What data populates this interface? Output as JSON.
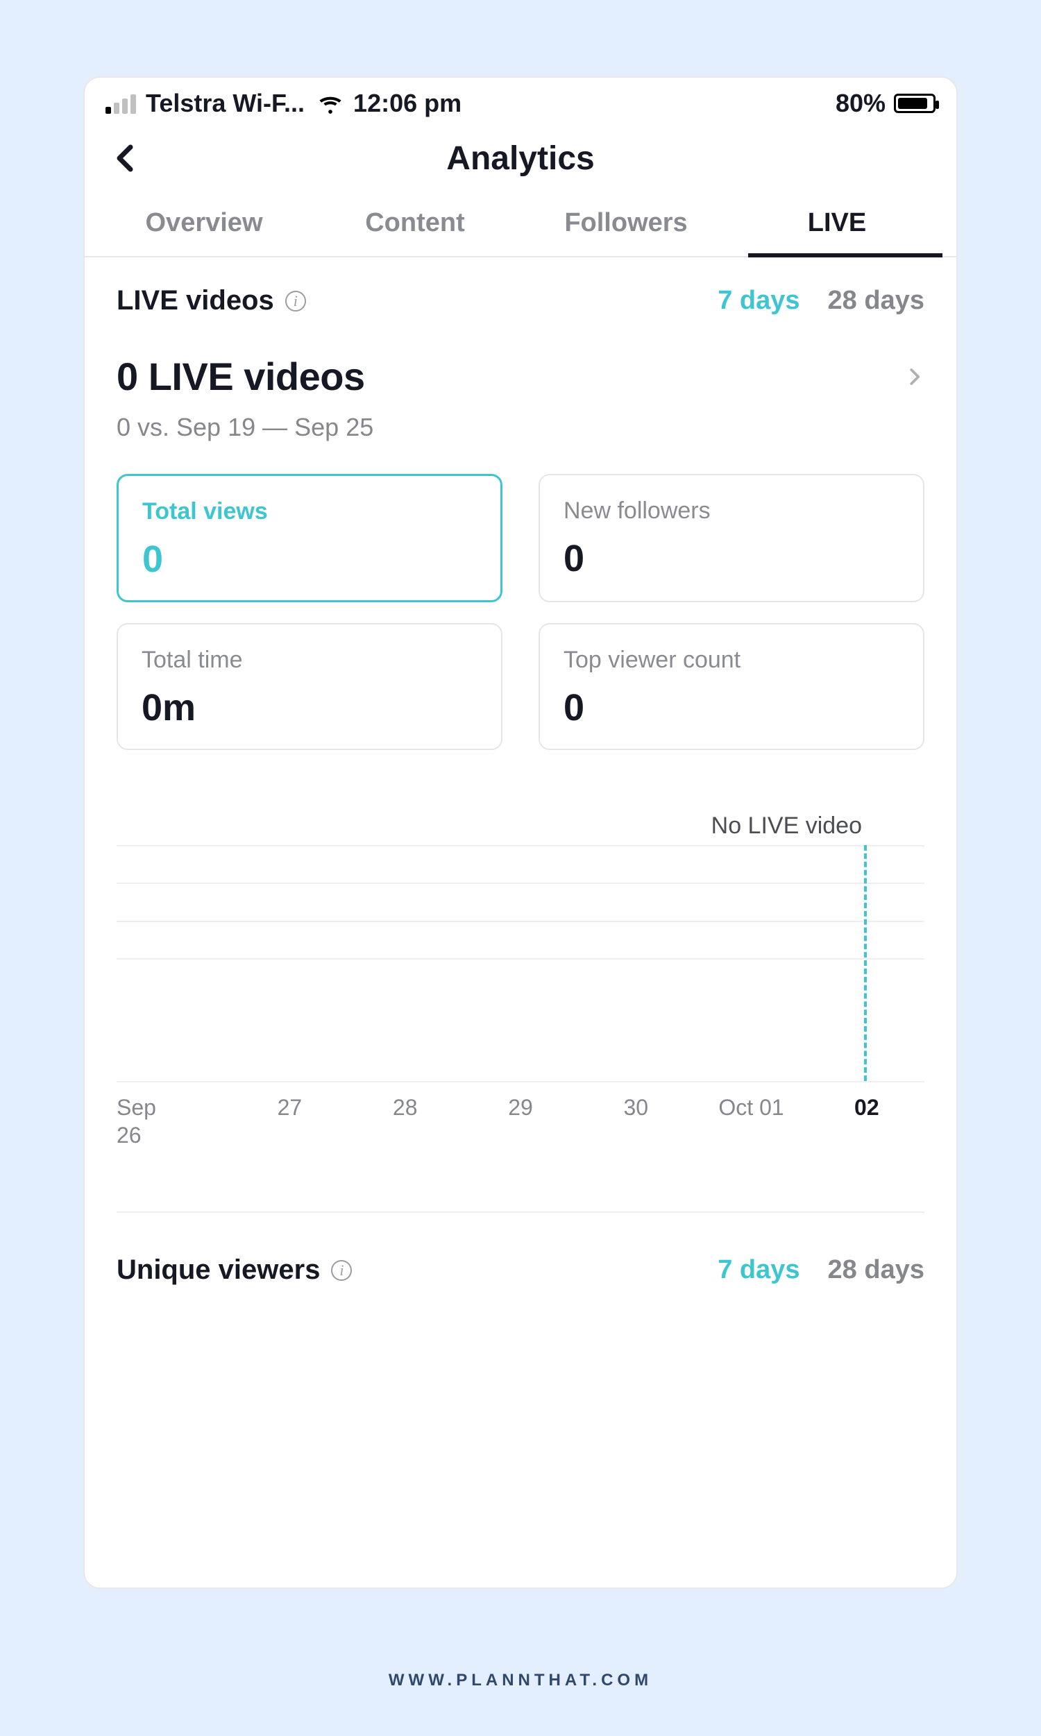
{
  "status_bar": {
    "carrier": "Telstra Wi-F...",
    "time": "12:06 pm",
    "battery_pct": "80%"
  },
  "nav": {
    "title": "Analytics"
  },
  "tabs": {
    "items": [
      "Overview",
      "Content",
      "Followers",
      "LIVE"
    ],
    "active_index": 3
  },
  "live_section": {
    "title": "LIVE videos",
    "range": {
      "opt_a": "7 days",
      "opt_b": "28 days",
      "active": "a"
    },
    "headline": "0 LIVE videos",
    "subline": "0 vs. Sep 19 — Sep 25",
    "cards": [
      {
        "title": "Total views",
        "value": "0",
        "active": true
      },
      {
        "title": "New followers",
        "value": "0",
        "active": false
      },
      {
        "title": "Total time",
        "value": "0m",
        "active": false
      },
      {
        "title": "Top viewer count",
        "value": "0",
        "active": false
      }
    ],
    "chart_note": "No LIVE video"
  },
  "unique_section": {
    "title": "Unique viewers",
    "range": {
      "opt_a": "7 days",
      "opt_b": "28 days",
      "active": "a"
    }
  },
  "chart_data": {
    "type": "line",
    "title": "LIVE videos — Total views",
    "xlabel": "",
    "ylabel": "",
    "categories": [
      "Sep 26",
      "27",
      "28",
      "29",
      "30",
      "Oct 01",
      "02"
    ],
    "series": [
      {
        "name": "Total views",
        "values": [
          0,
          0,
          0,
          0,
          0,
          0,
          0
        ]
      }
    ],
    "note": "No LIVE video",
    "highlight_index": 6,
    "ylim": [
      0,
      5
    ]
  },
  "footer": {
    "url": "WWW.PLANNTHAT.COM"
  }
}
